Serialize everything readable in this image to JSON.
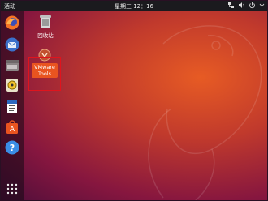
{
  "topbar": {
    "activities_label": "活动",
    "clock": "星期三 12：16",
    "tray": {
      "network_icon": "network-icon",
      "volume_icon": "volume-icon",
      "power_icon": "power-icon",
      "menu_icon": "chevron-down-icon"
    }
  },
  "dock": {
    "items": [
      {
        "name": "firefox-launcher",
        "icon": "firefox-icon"
      },
      {
        "name": "thunderbird-launcher",
        "icon": "mail-icon"
      },
      {
        "name": "files-launcher",
        "icon": "files-icon"
      },
      {
        "name": "rhythmbox-launcher",
        "icon": "music-icon"
      },
      {
        "name": "writer-launcher",
        "icon": "document-icon"
      },
      {
        "name": "software-launcher",
        "icon": "store-icon"
      },
      {
        "name": "help-launcher",
        "icon": "help-icon"
      }
    ],
    "show_apps_icon": "apps-grid-icon"
  },
  "desktop": {
    "trash_label": "回收站",
    "vmware_label_line1": "VMware",
    "vmware_label_line2": "Tools"
  },
  "colors": {
    "accent": "#e95420",
    "selection": "#e0141d",
    "topbar": "#1b1a1e"
  }
}
